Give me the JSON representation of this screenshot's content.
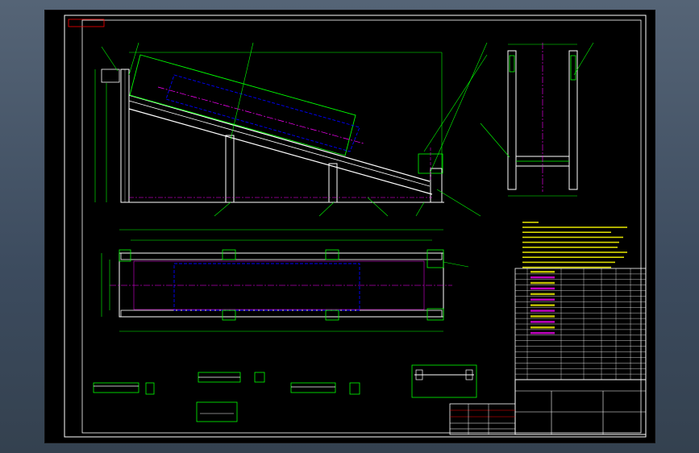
{
  "viewport": {
    "background": "#000000"
  },
  "colors": {
    "frame": "#ffffff",
    "outline": "#00ff00",
    "hidden": "#0000ff",
    "center": "#ff00ff",
    "dimension": "#00ff00",
    "leader": "#00ff00",
    "text_yellow": "#ffff00",
    "text_white": "#ffffff",
    "red": "#ff0000"
  },
  "title_tag": "",
  "views": {
    "front_label": "",
    "side_label": "",
    "top_label": "",
    "detail_labels": []
  },
  "leader_numbers": [],
  "dimensions": [],
  "notes": {
    "heading": "",
    "lines": []
  },
  "parts_list": {
    "header": [],
    "rows": []
  },
  "title_block": {
    "drawing_title": "",
    "spec_1": "",
    "spec_2": "",
    "scale": "",
    "drawing_no": "",
    "sheet": "",
    "company": ""
  }
}
